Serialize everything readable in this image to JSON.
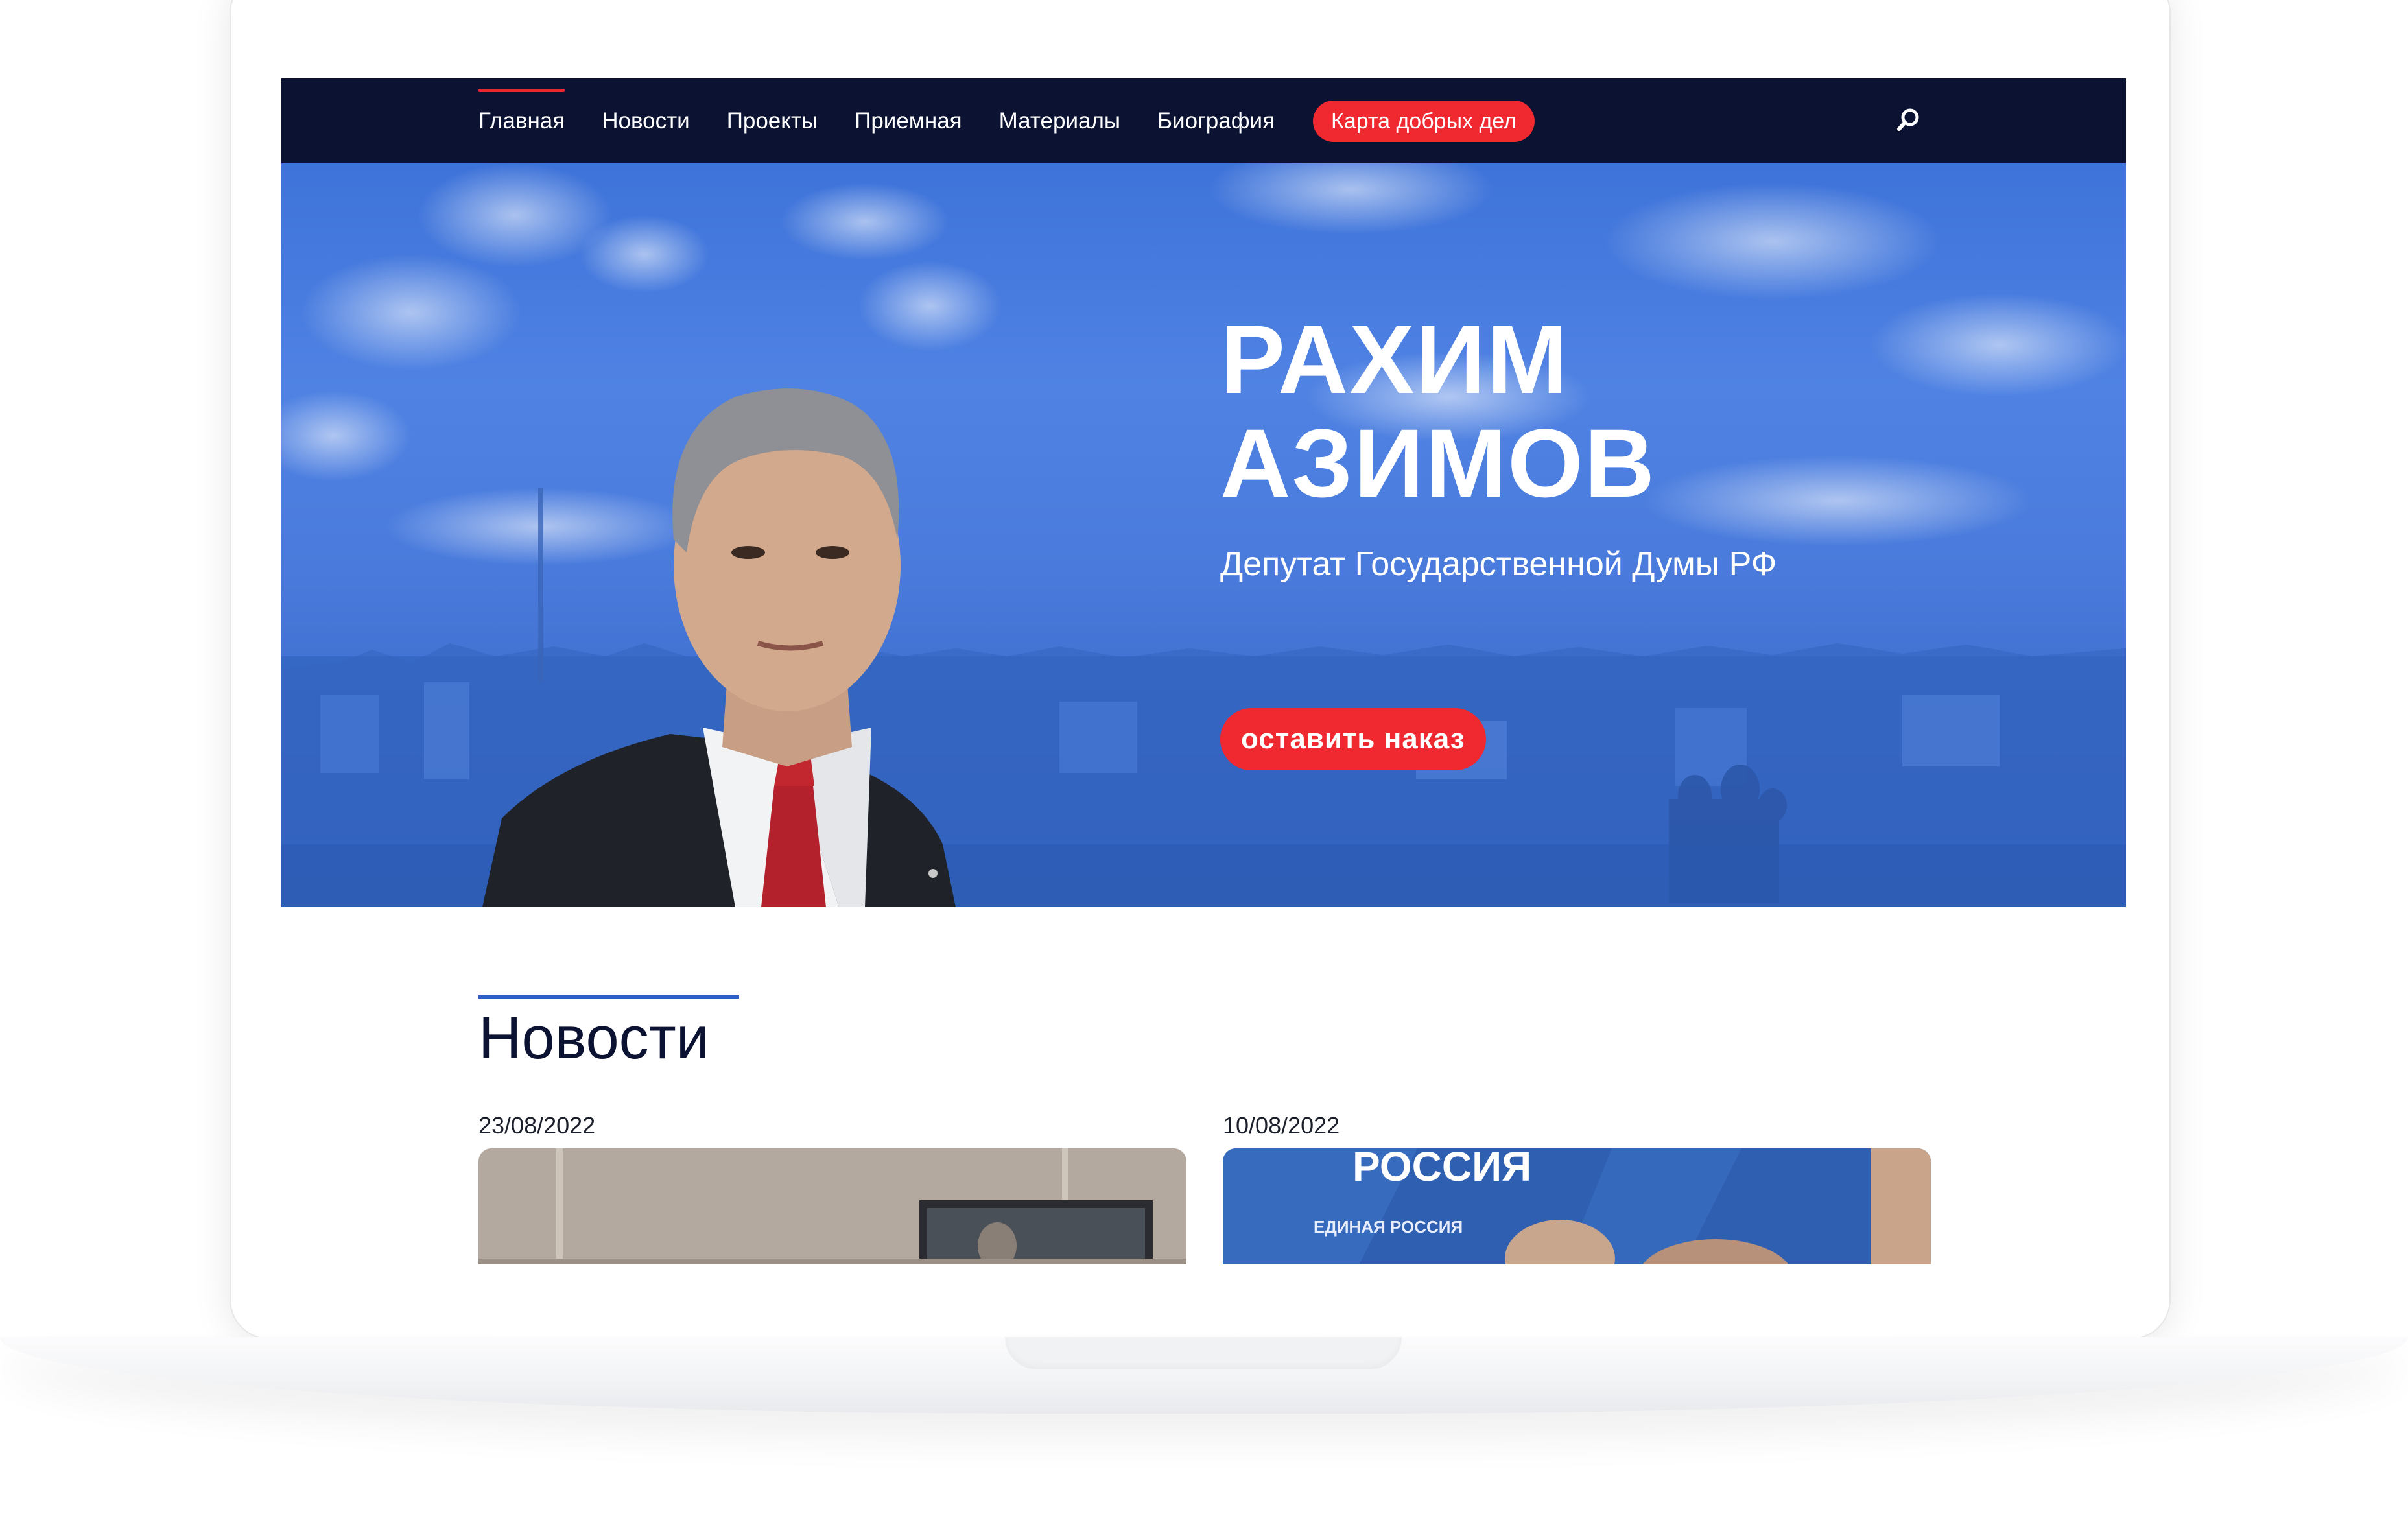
{
  "nav": {
    "items": [
      {
        "label": "Главная",
        "active": true
      },
      {
        "label": "Новости",
        "active": false
      },
      {
        "label": "Проекты",
        "active": false
      },
      {
        "label": "Приемная",
        "active": false
      },
      {
        "label": "Материалы",
        "active": false
      },
      {
        "label": "Биография",
        "active": false
      }
    ],
    "cta_label": "Карта добрых дел",
    "search_icon": "search-icon"
  },
  "hero": {
    "name_line1": "РАХИМ",
    "name_line2": "АЗИМОВ",
    "subtitle": "Депутат Государственной Думы РФ",
    "cta_label": "оставить наказ"
  },
  "news": {
    "title": "Новости",
    "items": [
      {
        "date": "23/08/2022"
      },
      {
        "date": "10/08/2022",
        "banner_text": "РОССИЯ",
        "logo_text": "ЕДИНАЯ РОССИЯ"
      }
    ]
  },
  "colors": {
    "nav_bg": "#0b1232",
    "accent_red": "#f0282f",
    "hero_blue": "#4a7bdc",
    "news_rule": "#2d5fc9"
  }
}
